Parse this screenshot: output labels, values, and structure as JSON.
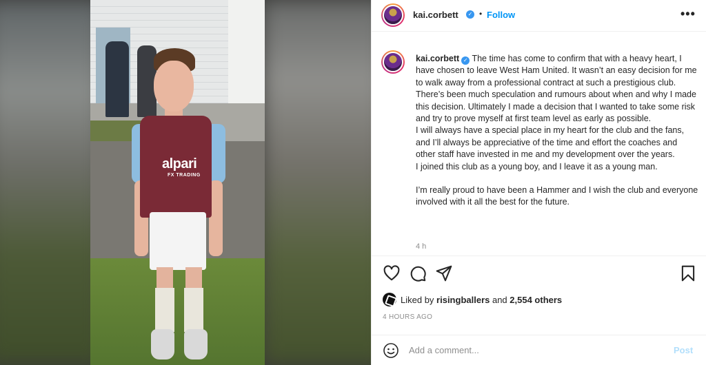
{
  "post": {
    "username": "kai.corbett",
    "follow_label": "Follow",
    "more_label": "•••",
    "separator": "•",
    "verified_mark": "✓",
    "caption_paragraphs": [
      " The time has come to confirm that with a heavy heart, I have chosen to leave West Ham United. It wasn’t an easy decision for me to walk away from a professional contract at such a prestigious club. There’s been much speculation and rumours about when and why I made this decision. Ultimately I made a decision that I wanted to take some risk and try to prove myself at first team level as early as possible.",
      "I will always have a special place in my heart for the club and the fans, and I’ll always be appreciative of the time and effort the coaches and other staff have invested in me and my development over the years.",
      "I joined this club as a young boy, and I leave it as a young man.",
      "I’m really proud to have been a Hammer and I wish the club and everyone involved with it all the best for the future."
    ],
    "caption_age": "4 h",
    "likes": {
      "prefix": "Liked by ",
      "user": "risingballers",
      "middle": " and ",
      "count": "2,554 others"
    },
    "posted_time": "4 HOURS AGO",
    "comment_placeholder": "Add a comment...",
    "post_button": "Post",
    "photo_text": {
      "shirt_sponsor": "alpari",
      "shirt_sub": "FX TRADING"
    }
  },
  "icons": [
    "heart-icon",
    "comment-icon",
    "share-icon",
    "bookmark-icon",
    "emoji-icon",
    "more-icon",
    "verified-icon"
  ],
  "colors": {
    "link_blue": "#0095f6",
    "post_disabled": "#b2dffc",
    "muted_text": "#8e8e8e",
    "verified_badge": "#3897f0"
  }
}
